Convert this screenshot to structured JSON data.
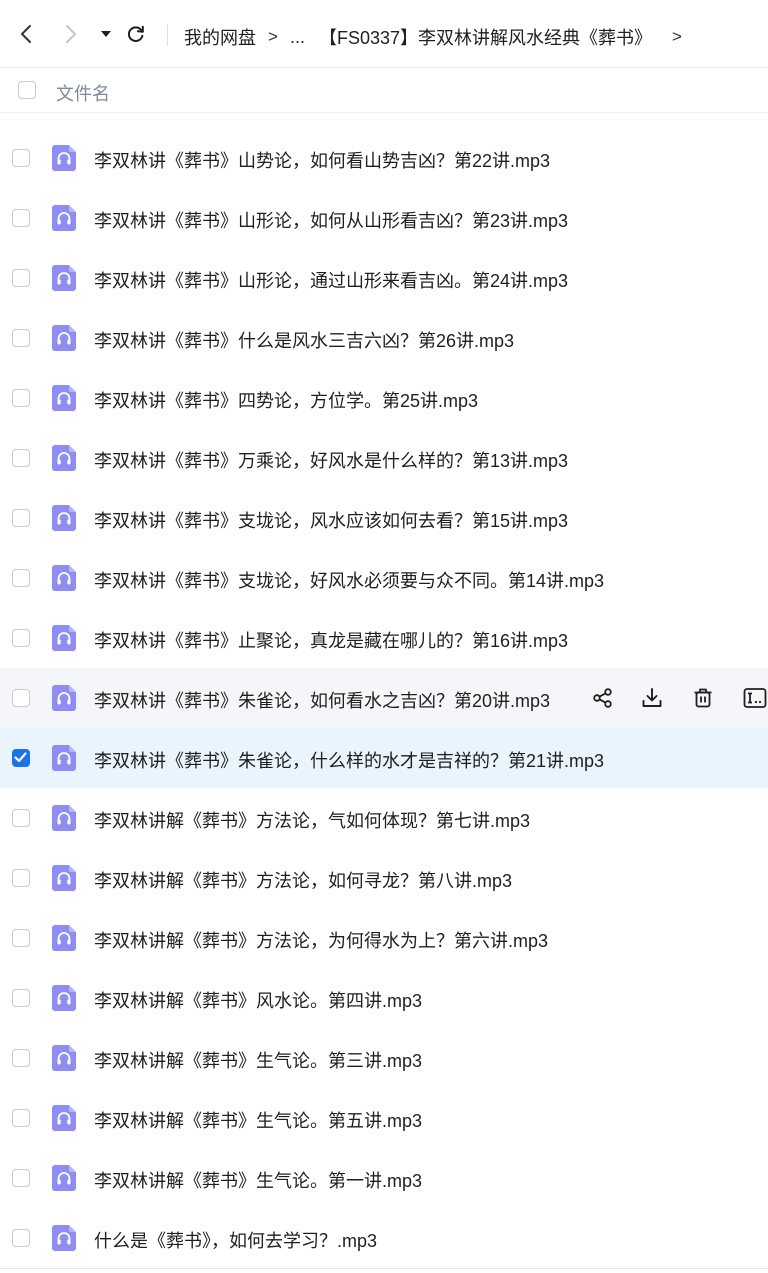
{
  "breadcrumb": {
    "root": "我的网盘",
    "ellipsis": "...",
    "current": "【FS0337】李双林讲解风水经典《葬书》",
    "separator": ">"
  },
  "header": {
    "column_label": "文件名"
  },
  "files": [
    {
      "name": "李双林讲《葬书》山势论，如何看山势吉凶？第22讲.mp3"
    },
    {
      "name": "李双林讲《葬书》山形论，如何从山形看吉凶？第23讲.mp3"
    },
    {
      "name": "李双林讲《葬书》山形论，通过山形来看吉凶。第24讲.mp3"
    },
    {
      "name": "李双林讲《葬书》什么是风水三吉六凶？第26讲.mp3"
    },
    {
      "name": "李双林讲《葬书》四势论，方位学。第25讲.mp3"
    },
    {
      "name": "李双林讲《葬书》万乘论，好风水是什么样的？第13讲.mp3"
    },
    {
      "name": "李双林讲《葬书》支垅论，风水应该如何去看？第15讲.mp3"
    },
    {
      "name": "李双林讲《葬书》支垅论，好风水必须要与众不同。第14讲.mp3"
    },
    {
      "name": "李双林讲《葬书》止聚论，真龙是藏在哪儿的？第16讲.mp3"
    },
    {
      "name": "李双林讲《葬书》朱雀论，如何看水之吉凶？第20讲.mp3"
    },
    {
      "name": "李双林讲《葬书》朱雀论，什么样的水才是吉祥的？第21讲.mp3"
    },
    {
      "name": "李双林讲解《葬书》方法论，气如何体现？第七讲.mp3"
    },
    {
      "name": "李双林讲解《葬书》方法论，如何寻龙？第八讲.mp3"
    },
    {
      "name": "李双林讲解《葬书》方法论，为何得水为上？第六讲.mp3"
    },
    {
      "name": "李双林讲解《葬书》风水论。第四讲.mp3"
    },
    {
      "name": "李双林讲解《葬书》生气论。第三讲.mp3"
    },
    {
      "name": "李双林讲解《葬书》生气论。第五讲.mp3"
    },
    {
      "name": "李双林讲解《葬书》生气论。第一讲.mp3"
    },
    {
      "name": "什么是《葬书》，如何去学习？.mp3"
    }
  ],
  "hovered_row": "李双林讲《葬书》朱雀论，如何看水之吉凶？第20讲.mp3",
  "selected_row": "李双林讲《葬书》朱雀论，什么样的水才是吉祥的？第21讲.mp3",
  "icons": {
    "file_type": "audio-file-icon",
    "row_actions": [
      "share-icon",
      "download-icon",
      "delete-icon",
      "rename-icon"
    ]
  },
  "colors": {
    "accent": "#1a73e8",
    "audio_icon": "#8f8cf2",
    "selected_row_bg": "#eaf4fd",
    "hover_row_bg": "#f5f6f9"
  }
}
